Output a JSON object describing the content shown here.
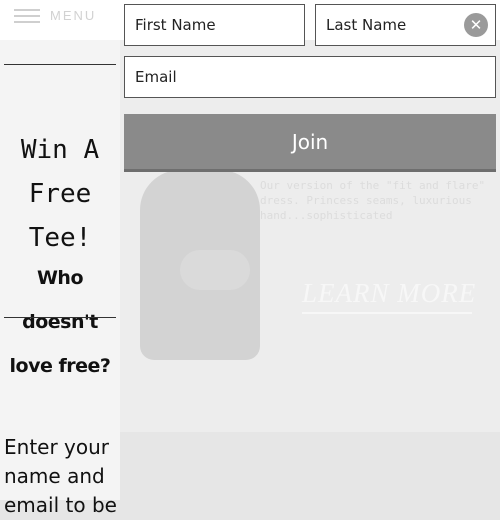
{
  "header": {
    "menu_label": "MENU"
  },
  "hero": {
    "description": "Our version of the \"fit and flare\" dress. Princess seams, luxurious hand...sophisticated",
    "cta_label": "LEARN MORE"
  },
  "signup": {
    "headline": "Win A Free Tee!",
    "subheadline": "Who doesn't love free?",
    "prompt": "Enter your name and email to be",
    "first_name_placeholder": "First Name",
    "last_name_placeholder": "Last Name",
    "email_placeholder": "Email",
    "close_symbol": "✕",
    "join_label": "Join"
  },
  "colors": {
    "join_button": "#8a8a8a",
    "close_button": "#9a9a9a",
    "overlay_background": "#e6e6e6",
    "sidebar_background": "#f4f4f4"
  },
  "icons": [
    "hamburger-icon",
    "close-icon"
  ]
}
